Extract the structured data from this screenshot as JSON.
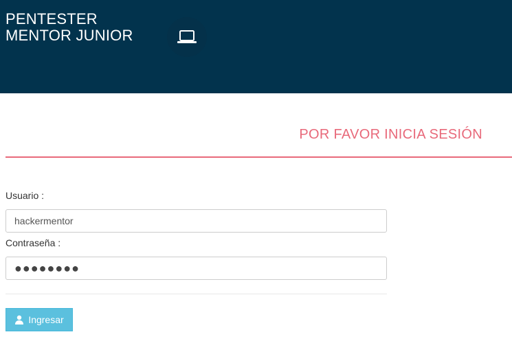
{
  "header": {
    "brand_line1": "PENTESTER",
    "brand_line2": "MENTOR JUNIOR",
    "brand_icon": "laptop-icon",
    "background_color": "#02334d"
  },
  "login": {
    "title": "POR FAVOR INICIA SESIÓN",
    "accent_color": "#e8697a",
    "username_label": "Usuario :",
    "username_value": "hackermentor",
    "password_label": "Contraseña :",
    "password_value": "●●●●●●●●",
    "submit_label": "Ingresar",
    "submit_icon": "user-icon",
    "button_color": "#5bc0de"
  }
}
